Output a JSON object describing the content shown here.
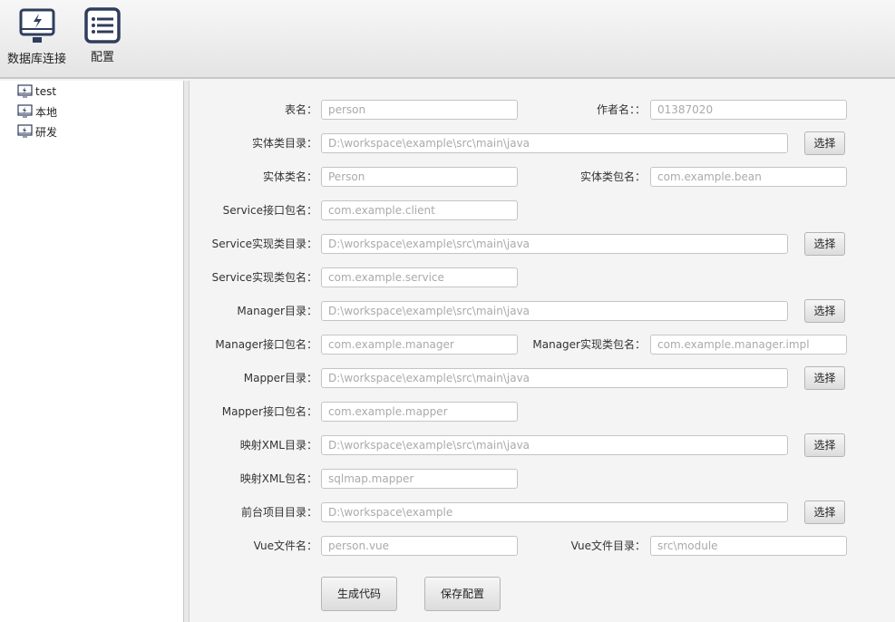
{
  "toolbar": {
    "db_connect": "数据库连接",
    "config": "配置"
  },
  "tree": [
    "test",
    "本地",
    "研发"
  ],
  "form": {
    "choose_label": "选择",
    "rows": [
      {
        "label": "表名：",
        "value": "person",
        "right_label": "作者名：：",
        "right_value": "01387020"
      },
      {
        "label": "实体类目录：",
        "value": "D:\\workspace\\example\\src\\main\\java",
        "wide": true
      },
      {
        "label": "实体类名：",
        "value": "Person",
        "right_label": "实体类包名：",
        "right_value": "com.example.bean"
      },
      {
        "label": "Service接口包名：",
        "value": "com.example.client"
      },
      {
        "label": "Service实现类目录：",
        "value": "D:\\workspace\\example\\src\\main\\java",
        "wide": true
      },
      {
        "label": "Service实现类包名：",
        "value": "com.example.service"
      },
      {
        "label": "Manager目录：",
        "value": "D:\\workspace\\example\\src\\main\\java",
        "wide": true
      },
      {
        "label": "Manager接口包名：",
        "value": "com.example.manager",
        "right_label": "Manager实现类包名：",
        "right_value": "com.example.manager.impl"
      },
      {
        "label": "Mapper目录：",
        "value": "D:\\workspace\\example\\src\\main\\java",
        "wide": true
      },
      {
        "label": "Mapper接口包名：",
        "value": "com.example.mapper"
      },
      {
        "label": "映射XML目录：",
        "value": "D:\\workspace\\example\\src\\main\\java",
        "wide": true
      },
      {
        "label": "映射XML包名：",
        "value": "sqlmap.mapper"
      },
      {
        "label": "前台项目目录：",
        "value": "D:\\workspace\\example",
        "wide": true
      },
      {
        "label": "Vue文件名：",
        "value": "person.vue",
        "right_label": "Vue文件目录：",
        "right_value": "src\\module"
      }
    ]
  },
  "actions": {
    "generate": "生成代码",
    "save": "保存配置"
  }
}
